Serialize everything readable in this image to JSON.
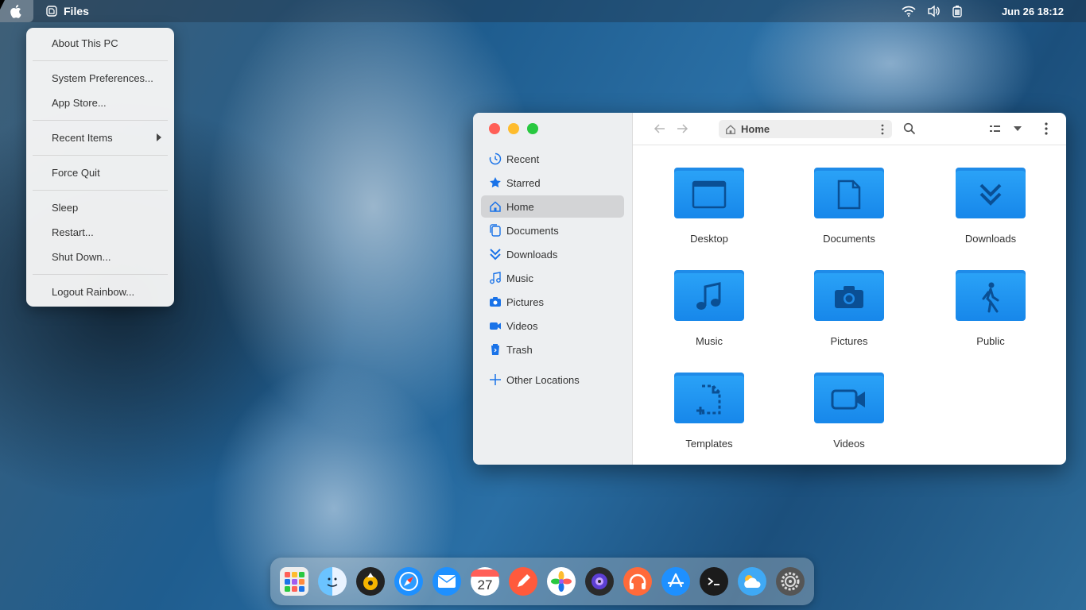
{
  "topbar": {
    "app_name": "Files",
    "clock": "Jun 26  18:12"
  },
  "apple_menu": {
    "items": [
      {
        "label": "About This PC"
      },
      {
        "label": "System Preferences..."
      },
      {
        "label": "App Store..."
      },
      {
        "label": "Recent Items"
      },
      {
        "label": "Force Quit"
      },
      {
        "label": "Sleep"
      },
      {
        "label": "Restart..."
      },
      {
        "label": "Shut Down..."
      },
      {
        "label": "Logout Rainbow..."
      }
    ]
  },
  "files_window": {
    "path": "Home",
    "sidebar": [
      {
        "label": "Recent",
        "icon": "clock-icon"
      },
      {
        "label": "Starred",
        "icon": "star-icon"
      },
      {
        "label": "Home",
        "icon": "home-icon"
      },
      {
        "label": "Documents",
        "icon": "document-icon"
      },
      {
        "label": "Downloads",
        "icon": "download-icon"
      },
      {
        "label": "Music",
        "icon": "music-icon"
      },
      {
        "label": "Pictures",
        "icon": "camera-icon"
      },
      {
        "label": "Videos",
        "icon": "video-icon"
      },
      {
        "label": "Trash",
        "icon": "trash-icon"
      },
      {
        "label": "Other Locations",
        "icon": "plus-icon"
      }
    ],
    "folders": [
      {
        "label": "Desktop",
        "icon": "window-icon"
      },
      {
        "label": "Documents",
        "icon": "document-icon"
      },
      {
        "label": "Downloads",
        "icon": "download-icon"
      },
      {
        "label": "Music",
        "icon": "music-icon"
      },
      {
        "label": "Pictures",
        "icon": "camera-icon"
      },
      {
        "label": "Public",
        "icon": "person-walking-icon"
      },
      {
        "label": "Templates",
        "icon": "template-icon"
      },
      {
        "label": "Videos",
        "icon": "video-icon"
      }
    ]
  },
  "dock": {
    "calendar_day": "27",
    "apps": [
      "launchpad",
      "finder",
      "music-player",
      "safari",
      "mail",
      "calendar",
      "notes",
      "photos",
      "screen-recorder",
      "headphones",
      "app-store",
      "terminal",
      "weather",
      "settings"
    ]
  },
  "colors": {
    "folder_blue": "#1f8be8",
    "accent_blue": "#1a73e8",
    "close_red": "#ff5f57",
    "minimize_yellow": "#febc2e",
    "maximize_green": "#28c840"
  }
}
